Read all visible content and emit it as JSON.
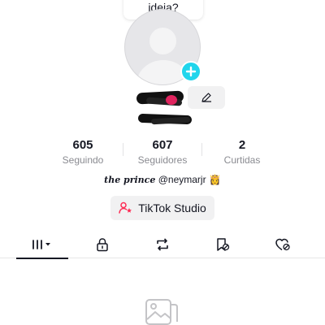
{
  "tooltip": {
    "text": "ideia?"
  },
  "profile": {
    "avatar_icon": "default-avatar-icon",
    "add_icon": "plus-icon",
    "edit_icon": "pencil-icon"
  },
  "stats": [
    {
      "value": "605",
      "label": "Seguindo"
    },
    {
      "value": "607",
      "label": "Seguidores"
    },
    {
      "value": "2",
      "label": "Curtidas"
    }
  ],
  "bio": {
    "script_name": "the prince",
    "handle": "@neymarjr",
    "emoji": "👸"
  },
  "studio_button": {
    "label": "TikTok Studio",
    "icon": "person-star-icon",
    "icon_color": "#fe2c55"
  },
  "tabs": [
    {
      "name": "videos-grid",
      "icon": "grid-bars-icon",
      "active": true
    },
    {
      "name": "private",
      "icon": "lock-icon",
      "active": false
    },
    {
      "name": "reposts",
      "icon": "repost-icon",
      "active": false
    },
    {
      "name": "favorites",
      "icon": "bookmark-icon",
      "active": false
    },
    {
      "name": "liked",
      "icon": "heart-hidden-icon",
      "active": false
    }
  ],
  "empty_state": {
    "icon": "image-placeholder-icon"
  },
  "colors": {
    "accent": "#20d5ec",
    "brand": "#fe2c55",
    "text": "#161823",
    "muted": "#8a8b91"
  }
}
